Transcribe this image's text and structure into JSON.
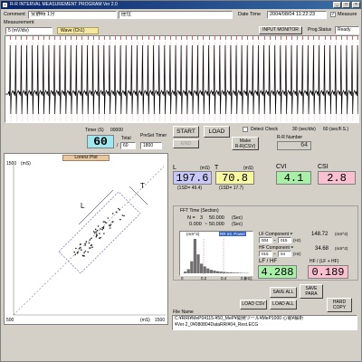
{
  "titlebar": {
    "title": "R-R INTERVAL MEASUREMENT PROGRAM  Ver 2.0"
  },
  "header": {
    "comment_label": "Comment",
    "comment_value": "安静時 1分",
    "comment_value2": "座位",
    "datetime_label": "Date Time",
    "datetime_value": "2004/08/04 11:22:23",
    "measure_label": "Measure",
    "measure_checked": true,
    "measurement_label": "Measurement"
  },
  "ecg": {
    "scale_value": "5",
    "scale_unit": "(mV/div)",
    "wave_label": "Wave (Ch1)",
    "input_monitor_label": "INPUT MONITOR",
    "prog_status_label": "Prog.Status",
    "prog_status_value": "Ready",
    "beat_count": 64
  },
  "controls": {
    "timer_label": "Timer (S)",
    "timer_counter": "00000",
    "timer_value": "60",
    "total_label": "Total",
    "total_value": "60",
    "preset_label": "PreSet Timer",
    "preset_value": "1800",
    "start_label": "START",
    "load_label": "LOAD",
    "end_label": "END",
    "make_label_line1": "Make",
    "make_label_line2": "R-R(CSV)",
    "detect_check_label": "Detect Check",
    "speed_label1": "30 (sec/div)",
    "speed_label2": "60 (sec/F.S.)",
    "rr_number_label": "R-R Number",
    "rr_number_value": "64"
  },
  "lorenz": {
    "tab_label": "Lorenz Plot",
    "y_max": "1500",
    "y_unit": "(mS)",
    "x_min": "500",
    "x_max": "1500",
    "x_unit": "(mS)",
    "l_axis_label": "L",
    "t_axis_label": "T"
  },
  "metrics": {
    "L": {
      "label": "L",
      "unit": "(mS)",
      "value": "197.6",
      "sd": "(1SD= 49.4)",
      "color": "#c8c8f8"
    },
    "T": {
      "label": "T",
      "unit": "(mS)",
      "value": "70.8",
      "sd": "(1SD= 17.7)",
      "color": "#f8f8a0"
    },
    "CVI": {
      "label": "CVI",
      "value": "4.1",
      "color": "#a8f0a8"
    },
    "CSI": {
      "label": "CSI",
      "value": "2.8",
      "color": "#f8c0d0"
    }
  },
  "fft": {
    "title": "FFT Time (Section)",
    "n_label": "N =",
    "n_value": "3",
    "t_unit": "(Sec)",
    "t_start": "50.000",
    "t_start2": "0.000",
    "t_end": "50.000",
    "sep": "~",
    "ylabel": "(mS^2)",
    "rr_label": "RR Int. Power",
    "x_ticks": [
      "0",
      "0.2",
      "0.4",
      "0.6"
    ],
    "hz_unit": "(Hz)",
    "bins": [
      0.05,
      0.12,
      0.35,
      1.0,
      0.55,
      0.28,
      0.2,
      0.14,
      0.1,
      0.08,
      0.06,
      0.05,
      0.04,
      0.03,
      0.03,
      0.02,
      0.02,
      0.015,
      0.01,
      0.01
    ]
  },
  "lf": {
    "label": "LF Component =",
    "value": "148.72",
    "unit": "(mS^2)",
    "range_lo": "004",
    "range_hi": "015",
    "range_unit": "(Hz)"
  },
  "hf": {
    "label": "HF Component =",
    "value": "34.68",
    "unit": "(mS^2)",
    "range_lo": "015",
    "range_hi": "04",
    "range_unit": "(Hz)"
  },
  "ratios": {
    "lfhf_label": "LF / HF",
    "lfhf_value": "4.288",
    "lfhf_color": "#a8f0a8",
    "hf_norm_label": "HF / (LF + HF)",
    "hf_norm_value": "0.189",
    "hf_norm_color": "#f8c0d0"
  },
  "buttons": {
    "save_all": "SAVE ALL",
    "save_para_line1": "SAVE",
    "save_para_line2": "PARA",
    "load_csv": "LOAD CSV",
    "load_all": "LOAD ALL",
    "hard_copy_line1": "HARD",
    "hard_copy_line2": "COPY"
  },
  "file": {
    "label": "File Name",
    "line1": "C:¥RRI¥MeP04115-¥50_MeP¥開発ツール¥MeP1000 心電¥解析",
    "line2": "¥Ver 2_0¥080804DataRRI¥04_Rest.ECG"
  }
}
